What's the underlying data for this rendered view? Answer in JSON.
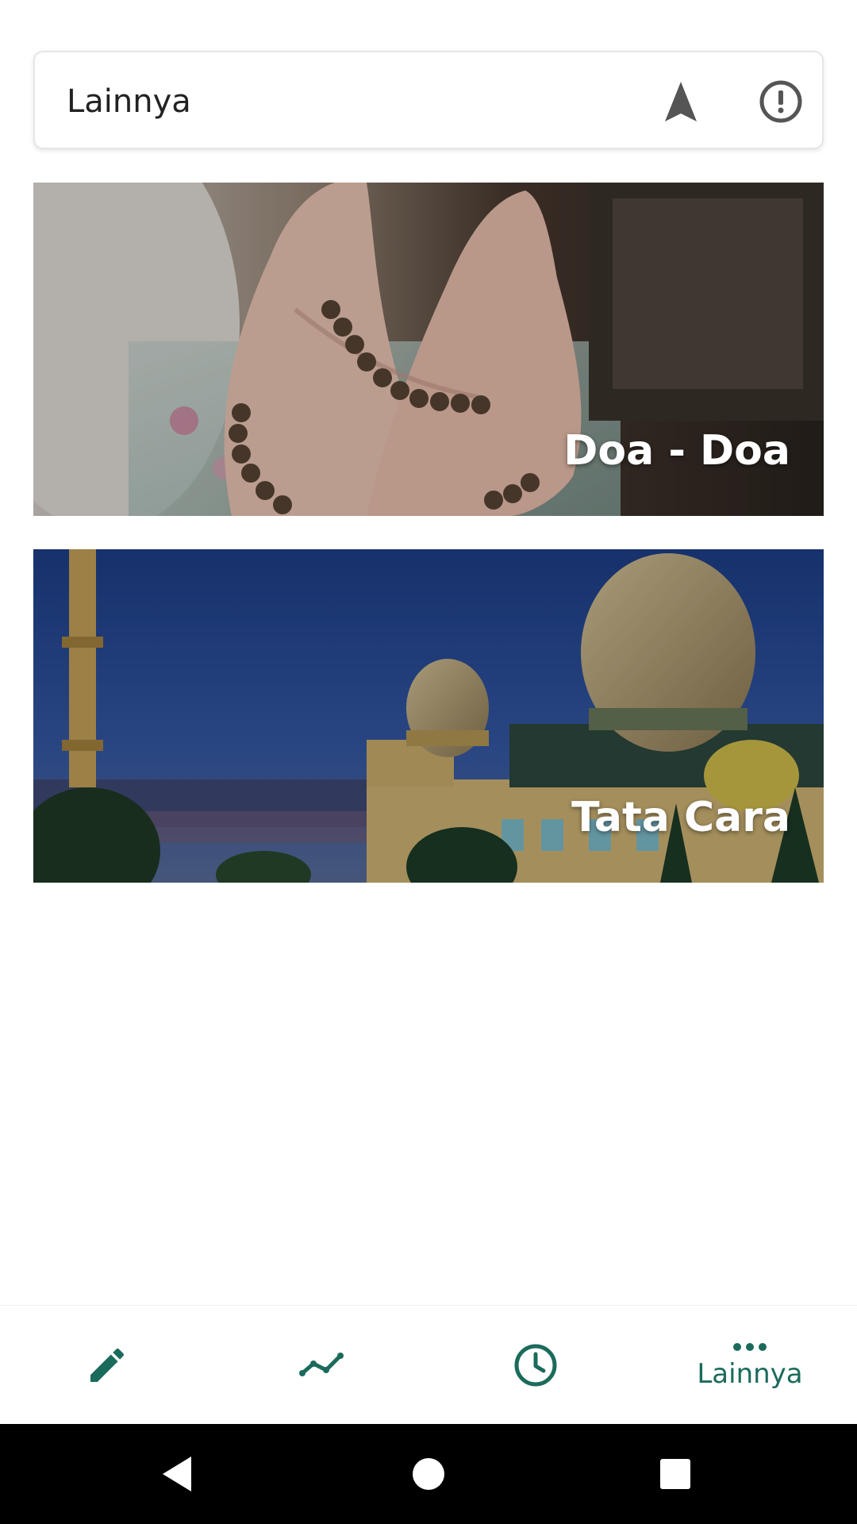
{
  "header": {
    "title": "Lainnya",
    "navigation_icon": "navigation-arrow-icon",
    "info_icon": "alert-circle-icon"
  },
  "banners": [
    {
      "label": "Doa - Doa",
      "image": "praying-hands-with-prayer-beads"
    },
    {
      "label": "Tata Cara",
      "image": "mosque-at-dusk"
    }
  ],
  "bottom_nav": {
    "items": [
      {
        "icon": "pencil-icon",
        "label": ""
      },
      {
        "icon": "trend-line-icon",
        "label": ""
      },
      {
        "icon": "clock-icon",
        "label": ""
      },
      {
        "icon": "more-horizontal-icon",
        "label": "Lainnya",
        "active": true
      }
    ]
  },
  "colors": {
    "accent": "#1b6b5c",
    "header_icon": "#555555",
    "system_bar": "#000000"
  }
}
